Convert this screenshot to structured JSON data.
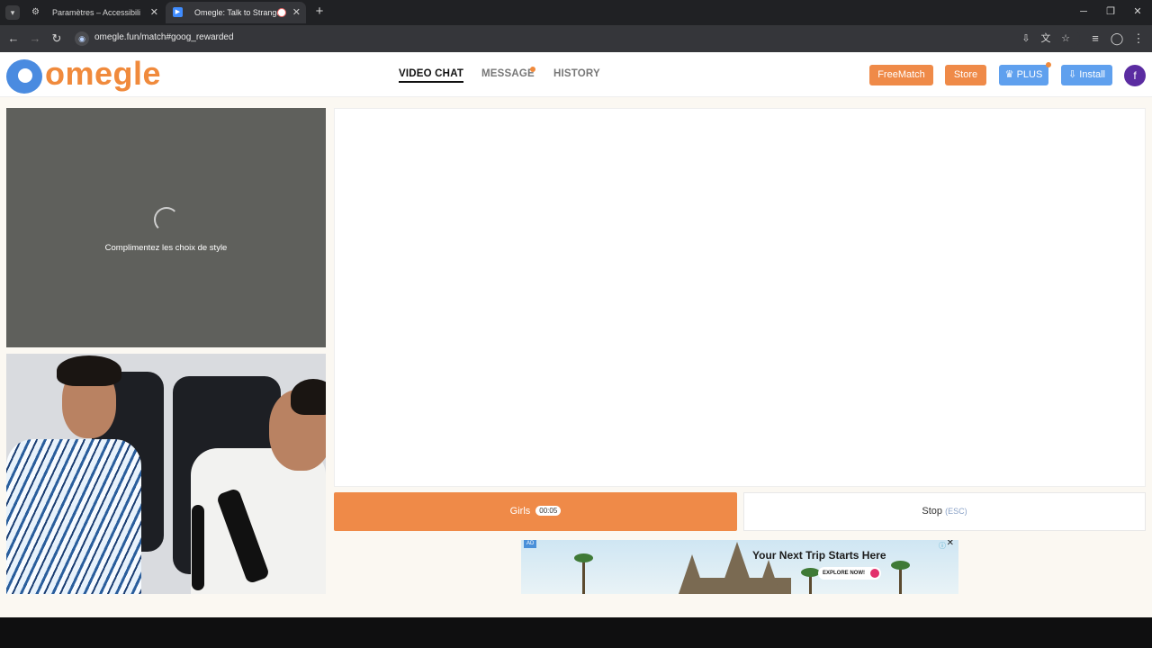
{
  "browser": {
    "tabs": [
      {
        "title": "Paramètres – Accessibilité",
        "icon": "gear-icon",
        "active": false
      },
      {
        "title": "Omegle: Talk to Strangers w",
        "icon": "video-icon",
        "active": true
      }
    ],
    "address": "omegle.fun/match#goog_rewarded"
  },
  "header": {
    "logo_text": "omegle",
    "nav": {
      "video_chat": "VIDEO CHAT",
      "message": "MESSAGE",
      "history": "HISTORY"
    },
    "buttons": {
      "freematch": "FreeMatch",
      "store": "Store",
      "plus": "PLUS",
      "install": "Install"
    },
    "avatar_letter": "f"
  },
  "stranger_video": {
    "status_text": "Complimentez les choix de style"
  },
  "controls": {
    "start_label": "Girls",
    "timer": "00:05",
    "stop_label": "Stop",
    "stop_hint": "(ESC)"
  },
  "ad": {
    "badge": "AD",
    "headline": "Your Next Trip Starts Here",
    "cta": "EXPLORE NOW!"
  },
  "colors": {
    "accent_orange": "#ef8a48",
    "accent_blue": "#5fa0ee",
    "avatar_purple": "#5b2ca1",
    "page_bg": "#fbf8f2"
  }
}
